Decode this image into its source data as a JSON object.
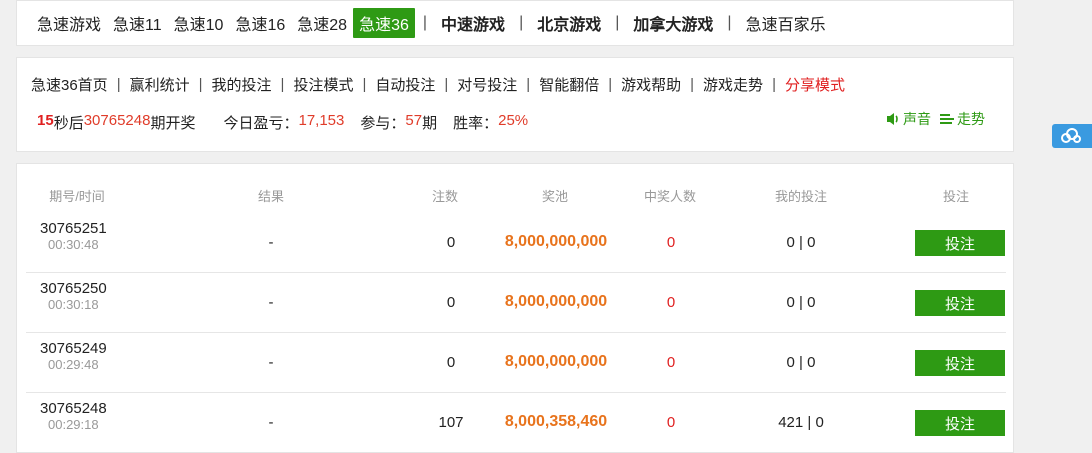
{
  "topnav": {
    "items": [
      {
        "label": "急速游戏",
        "style": "plain"
      },
      {
        "label": "急速11",
        "style": "plain"
      },
      {
        "label": "急速10",
        "style": "plain"
      },
      {
        "label": "急速16",
        "style": "plain"
      },
      {
        "label": "急速28",
        "style": "plain"
      },
      {
        "label": "急速36",
        "style": "active"
      },
      {
        "label": "中速游戏",
        "style": "bold"
      },
      {
        "label": "北京游戏",
        "style": "bold"
      },
      {
        "label": "加拿大游戏",
        "style": "bold"
      },
      {
        "label": "急速百家乐",
        "style": "plain"
      }
    ]
  },
  "subnav": {
    "items": [
      "急速36首页",
      "赢利统计",
      "我的投注",
      "投注模式",
      "自动投注",
      "对号投注",
      "智能翻倍",
      "游戏帮助",
      "游戏走势"
    ],
    "share_label": "分享模式"
  },
  "status": {
    "seconds": "15",
    "seconds_suffix": "秒后",
    "next_period": "30765248",
    "draw_text": "期开奖",
    "profit_label": "今日盈亏：",
    "profit_value": "17,153",
    "participate_label": "参与：",
    "participate_value": "57",
    "participate_unit": "期",
    "winrate_label": "胜率：",
    "winrate_value": "25%"
  },
  "tools": {
    "sound_label": "声音",
    "trend_label": "走势"
  },
  "table": {
    "headers": [
      "期号/时间",
      "结果",
      "注数",
      "奖池",
      "中奖人数",
      "我的投注",
      "投注"
    ],
    "rows": [
      {
        "period": "30765251",
        "time": "00:30:48",
        "result": "-",
        "bets": "0",
        "pool": "8,000,000,000",
        "winners": "0",
        "my_bet": "0 | 0",
        "action": "投注"
      },
      {
        "period": "30765250",
        "time": "00:30:18",
        "result": "-",
        "bets": "0",
        "pool": "8,000,000,000",
        "winners": "0",
        "my_bet": "0 | 0",
        "action": "投注"
      },
      {
        "period": "30765249",
        "time": "00:29:48",
        "result": "-",
        "bets": "0",
        "pool": "8,000,000,000",
        "winners": "0",
        "my_bet": "0 | 0",
        "action": "投注"
      },
      {
        "period": "30765248",
        "time": "00:29:18",
        "result": "-",
        "bets": "107",
        "pool": "8,000,358,460",
        "winners": "0",
        "my_bet": "421 | 0",
        "action": "投注"
      }
    ]
  },
  "colors": {
    "accent_green": "#2e9a14",
    "pool_orange": "#e8731c",
    "alert_red": "#e02020"
  },
  "icons": {
    "sound": "speaker-icon",
    "trend": "trend-lines-icon",
    "side": "cloud-share-icon"
  }
}
